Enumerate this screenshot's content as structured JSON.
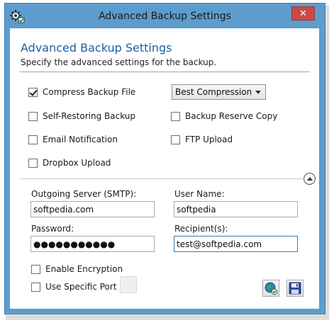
{
  "window": {
    "title": "Advanced Backup Settings",
    "close_glyph": "✕"
  },
  "header": {
    "title": "Advanced Backup Settings",
    "subtitle": "Specify the advanced settings for the backup."
  },
  "options": {
    "compress": {
      "label": "Compress Backup File",
      "checked": true
    },
    "compression_level": {
      "selected": "Best Compression"
    },
    "self_restoring": {
      "label": "Self-Restoring Backup",
      "checked": false
    },
    "reserve_copy": {
      "label": "Backup Reserve Copy",
      "checked": false
    },
    "email_notification": {
      "label": "Email Notification",
      "checked": false
    },
    "ftp_upload": {
      "label": "FTP Upload",
      "checked": false
    },
    "dropbox_upload": {
      "label": "Dropbox Upload",
      "checked": false
    }
  },
  "email": {
    "server_label": "Outgoing Server (SMTP):",
    "server_value": "softpedia.com",
    "username_label": "User Name:",
    "username_value": "softpedia",
    "password_label": "Password:",
    "password_value": "●●●●●●●●●●●",
    "recipients_label": "Recipient(s):",
    "recipients_value": "test@softpedia.com",
    "encryption": {
      "label": "Enable Encryption",
      "checked": false
    },
    "specific_port": {
      "label": "Use Specific Port",
      "checked": false
    }
  },
  "icons": {
    "app": "gear-icon",
    "collapse": "chevron-up-icon",
    "test_connection": "globe-icon",
    "save": "floppy-icon"
  },
  "colors": {
    "frame": "#5d9ccd",
    "header_title": "#1f5fa6",
    "close_button": "#c74b47"
  }
}
